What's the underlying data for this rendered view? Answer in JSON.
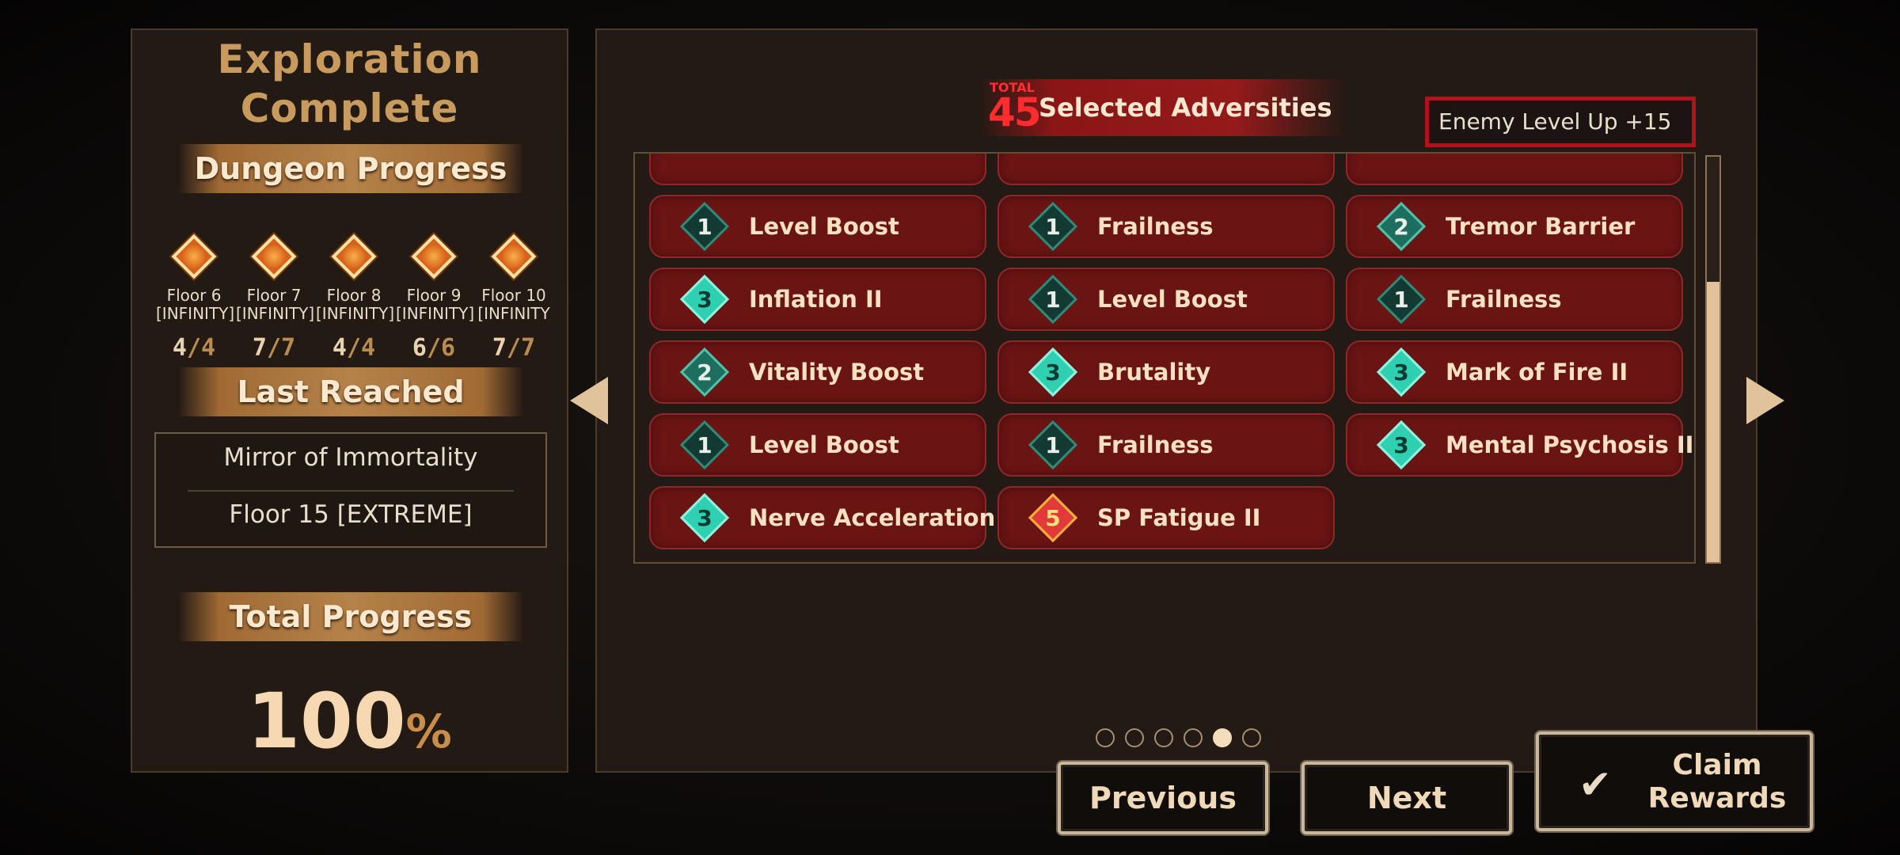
{
  "left": {
    "title": "Exploration\nComplete",
    "dungeon_progress_label": "Dungeon Progress",
    "floors": [
      {
        "name": "Floor 6\n[INFINITY]",
        "done": "4",
        "total": "4"
      },
      {
        "name": "Floor 7\n[INFINITY]",
        "done": "7",
        "total": "7"
      },
      {
        "name": "Floor 8\n[INFINITY]",
        "done": "4",
        "total": "4"
      },
      {
        "name": "Floor 9\n[INFINITY]",
        "done": "6",
        "total": "6"
      },
      {
        "name": "Floor 10\n[INFINITY",
        "done": "7",
        "total": "7"
      }
    ],
    "last_reached_label": "Last Reached",
    "last_reached_name": "Mirror of Immortality",
    "last_reached_floor": "Floor 15 [EXTREME]",
    "total_progress_label": "Total Progress",
    "total_progress_value": "100",
    "total_progress_unit": "%"
  },
  "adversities": {
    "total_label": "TOTAL",
    "total_value": "45",
    "title": "Selected Adversities",
    "enemy_level": "Enemy Level Up +15",
    "items": [
      {
        "level": "1",
        "name": "Level Boost"
      },
      {
        "level": "1",
        "name": "Frailness"
      },
      {
        "level": "2",
        "name": "Tremor Barrier"
      },
      {
        "level": "3",
        "name": "Inflation II"
      },
      {
        "level": "1",
        "name": "Level Boost"
      },
      {
        "level": "1",
        "name": "Frailness"
      },
      {
        "level": "2",
        "name": "Vitality Boost"
      },
      {
        "level": "3",
        "name": "Brutality"
      },
      {
        "level": "3",
        "name": "Mark of Fire II"
      },
      {
        "level": "1",
        "name": "Level Boost"
      },
      {
        "level": "1",
        "name": "Frailness"
      },
      {
        "level": "3",
        "name": "Mental Psychosis II"
      },
      {
        "level": "3",
        "name": "Nerve Acceleration II"
      },
      {
        "level": "5",
        "name": "SP Fatigue II"
      }
    ]
  },
  "pagination": {
    "pages": 6,
    "current": 5
  },
  "buttons": {
    "previous": "Previous",
    "next": "Next",
    "claim": "Claim\nRewards"
  },
  "colors": {
    "accent_red": "#b0131a",
    "item_bg": "#6b1414",
    "gold": "#c89a5e"
  }
}
